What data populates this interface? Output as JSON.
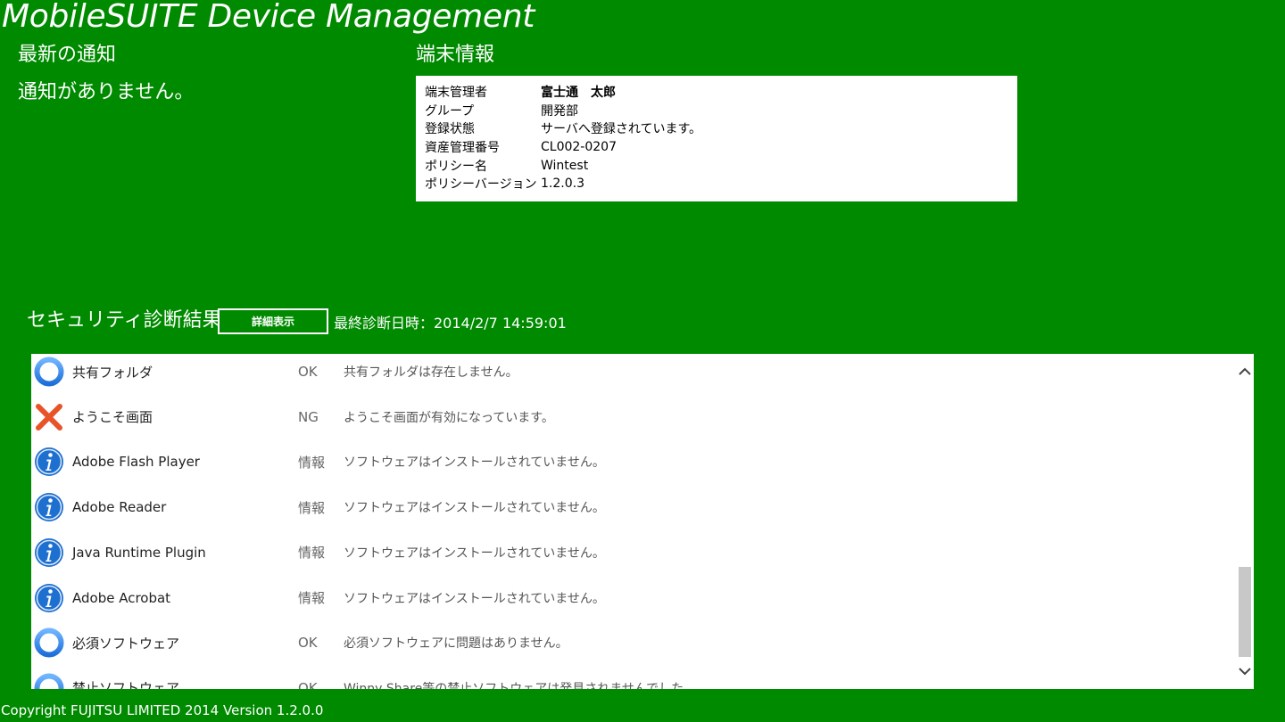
{
  "app": {
    "title": "MobileSUITE Device Management"
  },
  "notifications": {
    "heading": "最新の通知",
    "message": "通知がありません。"
  },
  "device_info": {
    "heading": "端末情報",
    "rows": [
      {
        "label": "端末管理者",
        "value": "富士通　太郎",
        "bold": true
      },
      {
        "label": "グループ",
        "value": "開発部"
      },
      {
        "label": "登録状態",
        "value": "サーバへ登録されています。"
      },
      {
        "label": "資産管理番号",
        "value": "CL002-0207"
      },
      {
        "label": "ポリシー名",
        "value": "Wintest"
      },
      {
        "label": "ポリシーバージョン",
        "value": "1.2.0.3"
      }
    ]
  },
  "security": {
    "heading": "セキュリティ診断結果",
    "detail_button_label": "詳細表示",
    "last_diagnosis": "最終診断日時：2014/2/7 14:59:01",
    "results": [
      {
        "icon": "ok-circle-icon",
        "name": "共有フォルダ",
        "status": "OK",
        "detail": "共有フォルダは存在しません。"
      },
      {
        "icon": "ng-cross-icon",
        "name": "ようこそ画面",
        "status": "NG",
        "detail": "ようこそ画面が有効になっています。"
      },
      {
        "icon": "info-icon",
        "name": "Adobe Flash Player",
        "status": "情報",
        "detail": "ソフトウェアはインストールされていません。"
      },
      {
        "icon": "info-icon",
        "name": "Adobe Reader",
        "status": "情報",
        "detail": "ソフトウェアはインストールされていません。"
      },
      {
        "icon": "info-icon",
        "name": "Java Runtime Plugin",
        "status": "情報",
        "detail": "ソフトウェアはインストールされていません。"
      },
      {
        "icon": "info-icon",
        "name": "Adobe Acrobat",
        "status": "情報",
        "detail": "ソフトウェアはインストールされていません。"
      },
      {
        "icon": "ok-circle-icon",
        "name": "必須ソフトウェア",
        "status": "OK",
        "detail": "必須ソフトウェアに問題はありません。"
      },
      {
        "icon": "ok-circle-icon",
        "name": "禁止ソフトウェア",
        "status": "OK",
        "detail": "Winny Share等の禁止ソフトウェアは発見されませんでした。"
      }
    ],
    "scroll": {
      "icons": [
        "chevron-up-icon",
        "chevron-down-icon"
      ],
      "thumb_start": 0.67,
      "thumb_fraction": 0.33
    }
  },
  "colors": {
    "background": "#008a00",
    "ok_blue": "#1e6fd9",
    "ng_red": "#e8532a",
    "info_blue": "#1d6fd0"
  },
  "footer": {
    "copyright": "Copyright FUJITSU LIMITED 2014  Version 1.2.0.0"
  }
}
